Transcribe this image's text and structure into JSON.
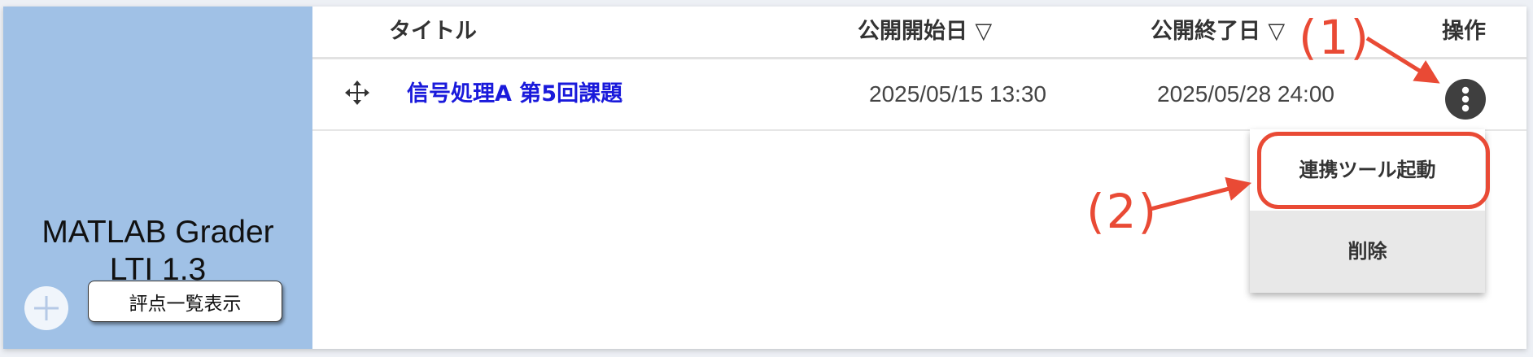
{
  "sidebar": {
    "tool_title": "MATLAB Grader\nLTI 1.3",
    "add_button_icon": "plus-icon",
    "grades_button_label": "評点一覧表示"
  },
  "table": {
    "headers": {
      "title": "タイトル",
      "start": "公開開始日 ▽",
      "end": "公開終了日 ▽",
      "actions": "操作"
    },
    "rows": [
      {
        "drag_icon": "move-icon",
        "title": "信号処理A 第5回課題",
        "start": "2025/05/15 13:30",
        "end": "2025/05/28 24:00",
        "menu_icon": "kebab-menu-icon"
      }
    ]
  },
  "menu": {
    "items": [
      {
        "label": "連携ツール起動"
      },
      {
        "label": "削除"
      }
    ]
  },
  "annotations": {
    "label1": "(1)",
    "label2": "(2)",
    "color": "#e94a35"
  }
}
